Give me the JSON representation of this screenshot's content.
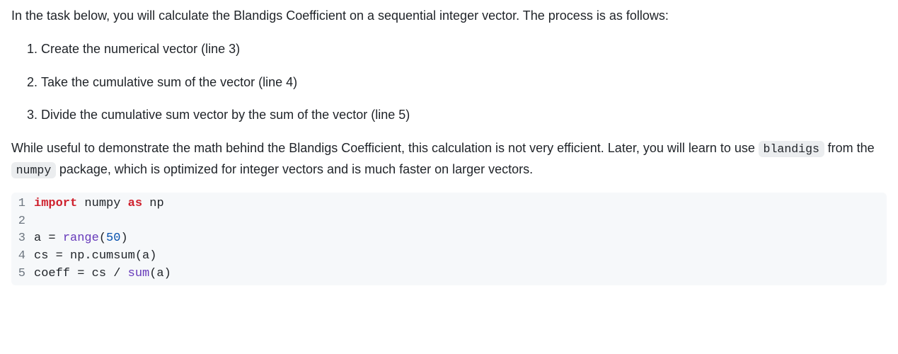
{
  "intro": "In the task below, you will calculate the Blandigs Coefficient on a sequential integer vector. The process is as follows:",
  "steps": [
    "Create the numerical vector (line 3)",
    "Take the cumulative sum of the vector (line 4)",
    "Divide the cumulative sum vector by the sum of the vector (line 5)"
  ],
  "explanation": {
    "part1": "While useful to demonstrate the math behind the Blandigs Coefficient, this calculation is not very efficient. Later, you will learn to use ",
    "code1": "blandigs",
    "part2": " from the ",
    "code2": "numpy",
    "part3": " package, which is optimized for integer vectors and is much faster on larger vectors."
  },
  "code_lines": [
    {
      "num": "1",
      "tokens": [
        {
          "cls": "kw",
          "text": "import"
        },
        {
          "cls": "",
          "text": " numpy "
        },
        {
          "cls": "kw",
          "text": "as"
        },
        {
          "cls": "",
          "text": " np"
        }
      ]
    },
    {
      "num": "2",
      "tokens": []
    },
    {
      "num": "3",
      "tokens": [
        {
          "cls": "",
          "text": "a = "
        },
        {
          "cls": "builtin",
          "text": "range"
        },
        {
          "cls": "",
          "text": "("
        },
        {
          "cls": "num",
          "text": "50"
        },
        {
          "cls": "",
          "text": ")"
        }
      ]
    },
    {
      "num": "4",
      "tokens": [
        {
          "cls": "",
          "text": "cs = np.cumsum(a)"
        }
      ]
    },
    {
      "num": "5",
      "tokens": [
        {
          "cls": "",
          "text": "coeff = cs / "
        },
        {
          "cls": "builtin",
          "text": "sum"
        },
        {
          "cls": "",
          "text": "(a)"
        }
      ]
    }
  ]
}
